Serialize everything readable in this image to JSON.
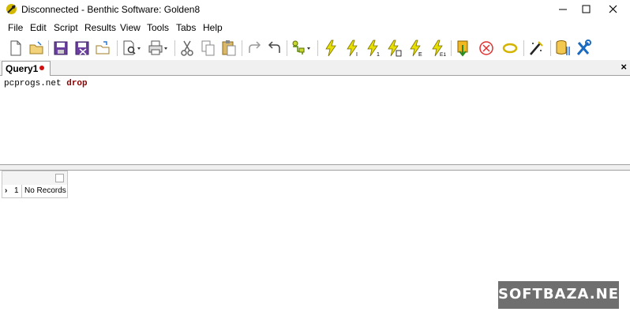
{
  "window": {
    "title": "Disconnected - Benthic Software: Golden8"
  },
  "menu": [
    "File",
    "Edit",
    "Script",
    "Results",
    "View",
    "Tools",
    "Tabs",
    "Help"
  ],
  "toolbar": {
    "icons": [
      "new-file-icon",
      "open-folder-icon",
      "save-icon",
      "save-as-icon",
      "open-recent-icon",
      "find-icon",
      "print-icon",
      "cut-icon",
      "copy-icon",
      "paste-icon",
      "redo-icon",
      "undo-icon",
      "explain-plan-icon",
      "execute-icon",
      "execute-current-icon",
      "execute-one-icon",
      "execute-script-icon",
      "execute-explain-icon",
      "execute-e1-icon",
      "commit-icon",
      "cancel-icon",
      "rollback-icon",
      "format-icon",
      "connection-settings-icon",
      "tools-icon"
    ]
  },
  "tabs": [
    {
      "label": "Query1",
      "modified": true
    }
  ],
  "tab_close": "×",
  "editor": {
    "text_plain": "pcprogs.net ",
    "text_keyword": "drop"
  },
  "results": {
    "rows": [
      {
        "arrow": "›",
        "num": "1",
        "value": "No Records"
      }
    ]
  },
  "watermark": "SOFTBAZA.NET",
  "colors": {
    "modified_dot": "#d01010",
    "keyword": "#8b0000",
    "lightning": "#e8e000",
    "cancel": "#e03030"
  }
}
